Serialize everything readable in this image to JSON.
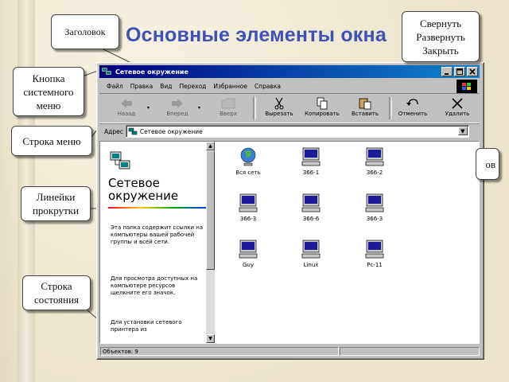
{
  "slide": {
    "title": "Основные элементы окна"
  },
  "callouts": {
    "header": "Заголовок",
    "controls": [
      "Свернуть",
      "Развернуть",
      "Закрыть"
    ],
    "system_menu": [
      "Кнопка",
      "системного",
      "меню"
    ],
    "menu_bar": "Строка меню",
    "partial_right": "ов",
    "scrollbars": [
      "Линейки",
      "прокрутки"
    ],
    "status": [
      "Строка",
      "состояния"
    ]
  },
  "window": {
    "title": "Сетевое окружение",
    "menu": [
      "Файл",
      "Правка",
      "Вид",
      "Переход",
      "Избранное",
      "Справка"
    ],
    "toolbar": {
      "back": "Назад",
      "forward": "Вперед",
      "up": "Вверх",
      "cut": "Вырезать",
      "copy": "Копировать",
      "paste": "Вставить",
      "undo": "Отменить",
      "delete": "Удалить"
    },
    "address": {
      "label": "Адрес",
      "value": "Сетевое окружение"
    },
    "left_pane": {
      "heading_line1": "Сетевое",
      "heading_line2": "окружение",
      "para1": "Эта папка содержит ссылки на компьютеры вашей рабочей группы и всей сети.",
      "para2": "Для просмотра доступных на компьютере ресурсов щелкните его значок.",
      "para3": "Для установки сетевого принтера из"
    },
    "items": [
      {
        "label": "Вся сеть",
        "icon": "globe-icon"
      },
      {
        "label": "366-1",
        "icon": "computer-icon"
      },
      {
        "label": "366-2",
        "icon": "computer-icon"
      },
      {
        "label": "366-3",
        "icon": "computer-icon"
      },
      {
        "label": "366-6",
        "icon": "computer-icon"
      },
      {
        "label": "366-3",
        "icon": "computer-icon"
      },
      {
        "label": "Guy",
        "icon": "computer-icon"
      },
      {
        "label": "Linux",
        "icon": "computer-icon"
      },
      {
        "label": "Pc-11",
        "icon": "computer-icon"
      }
    ],
    "status": "Объектов: 9"
  },
  "colors": {
    "title_blue": "#3f51b5",
    "titlebar_start": "#000080",
    "titlebar_end": "#1084d0",
    "window_face": "#c0c0c0"
  }
}
